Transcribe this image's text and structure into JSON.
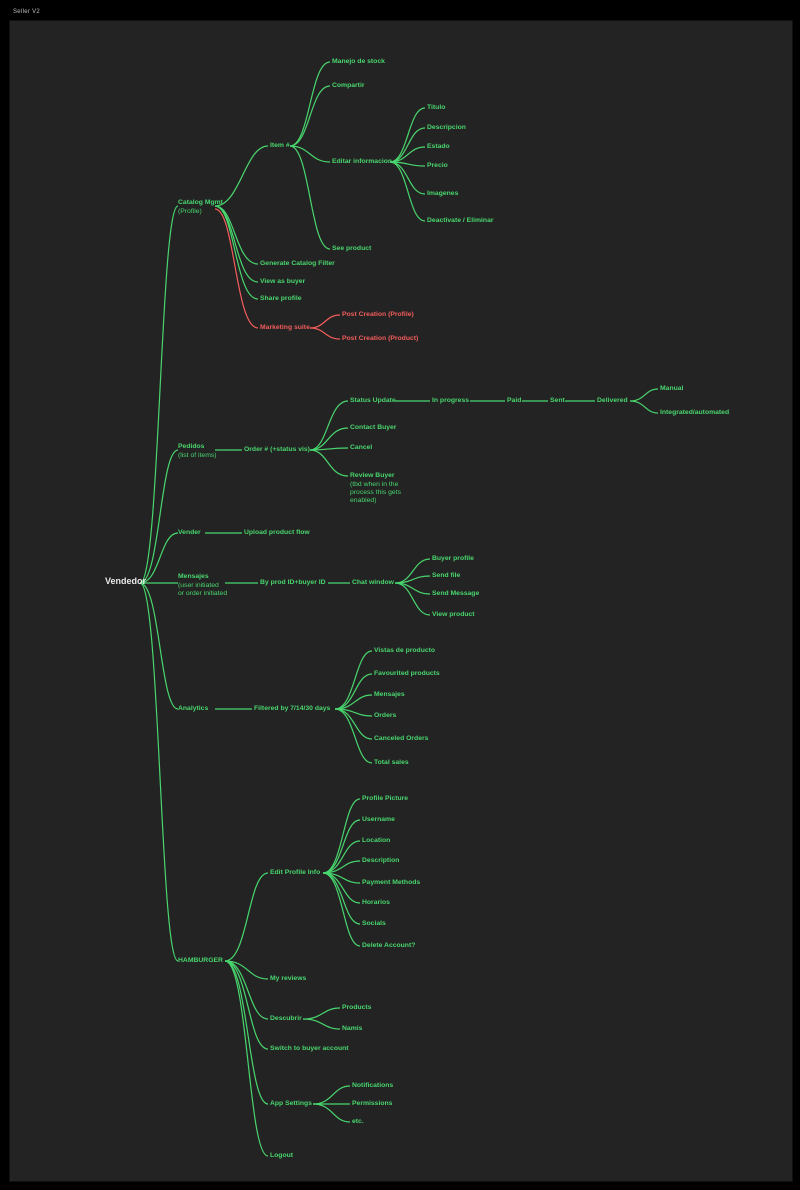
{
  "title": "Seller V2",
  "root": "Vendedor",
  "catalog": {
    "label": "Catalog Mgmt",
    "sub": "(Profile)",
    "item": "Item #",
    "item_children": {
      "stock": "Manejo de stock",
      "share": "Compartir",
      "edit": "Editar informacion",
      "see": "See product"
    },
    "edit_children": {
      "titulo": "Titulo",
      "desc": "Descripcion",
      "estado": "Estado",
      "precio": "Precio",
      "img": "Imagenes",
      "deact": "Deactivate / Eliminar"
    },
    "filter": "Generate Catalog Filter",
    "viewbuyer": "View as buyer",
    "shareprof": "Share profile",
    "marketing": "Marketing suite",
    "marketing_children": {
      "profile": "Post Creation (Profile)",
      "product": "Post Creation (Product)"
    }
  },
  "pedidos": {
    "label": "Pedidos",
    "sub": "(list of items)",
    "order": "Order # (+status vis)",
    "children": {
      "status": "Status Update",
      "contact": "Contact Buyer",
      "cancel": "Cancel",
      "review": "Review Buyer",
      "review_sub1": "(tbd when in the",
      "review_sub2": "process this gets",
      "review_sub3": "enabled)"
    },
    "status_chain": {
      "inprog": "In progress",
      "paid": "Paid",
      "sent": "Sent",
      "delivered": "Delivered",
      "manual": "Manual",
      "auto": "Integrated/automated"
    }
  },
  "vender": {
    "label": "Vender",
    "upload": "Upload product flow"
  },
  "mensajes": {
    "label": "Mensajes",
    "sub1": "(user initiated",
    "sub2": "or order initiated",
    "byid": "By prod ID+buyer ID",
    "chat": "Chat window",
    "children": {
      "buyer": "Buyer profile",
      "file": "Send file",
      "msg": "Send Message",
      "view": "View product"
    }
  },
  "analytics": {
    "label": "Analytics",
    "filter": "Filtered by 7/14/30 days",
    "children": {
      "vistas": "Vistas de producto",
      "fav": "Favourited products",
      "msgs": "Mensajes",
      "orders": "Orders",
      "cancel": "Canceled Orders",
      "sales": "Total sales"
    }
  },
  "hamburger": {
    "label": "HAMBURGER",
    "edit": "Edit Profile Info",
    "edit_children": {
      "pic": "Profile Picture",
      "user": "Username",
      "loc": "Location",
      "desc": "Description",
      "pay": "Payment Methods",
      "hor": "Horarios",
      "soc": "Socials",
      "del": "Delete Account?"
    },
    "reviews": "My reviews",
    "descubrir": "Descubrir",
    "descubrir_children": {
      "prod": "Products",
      "namis": "Namis"
    },
    "switch": "Switch to buyer account",
    "settings": "App Settings",
    "settings_children": {
      "notif": "Notifications",
      "perm": "Permissions",
      "etc": "etc."
    },
    "logout": "Logout"
  }
}
